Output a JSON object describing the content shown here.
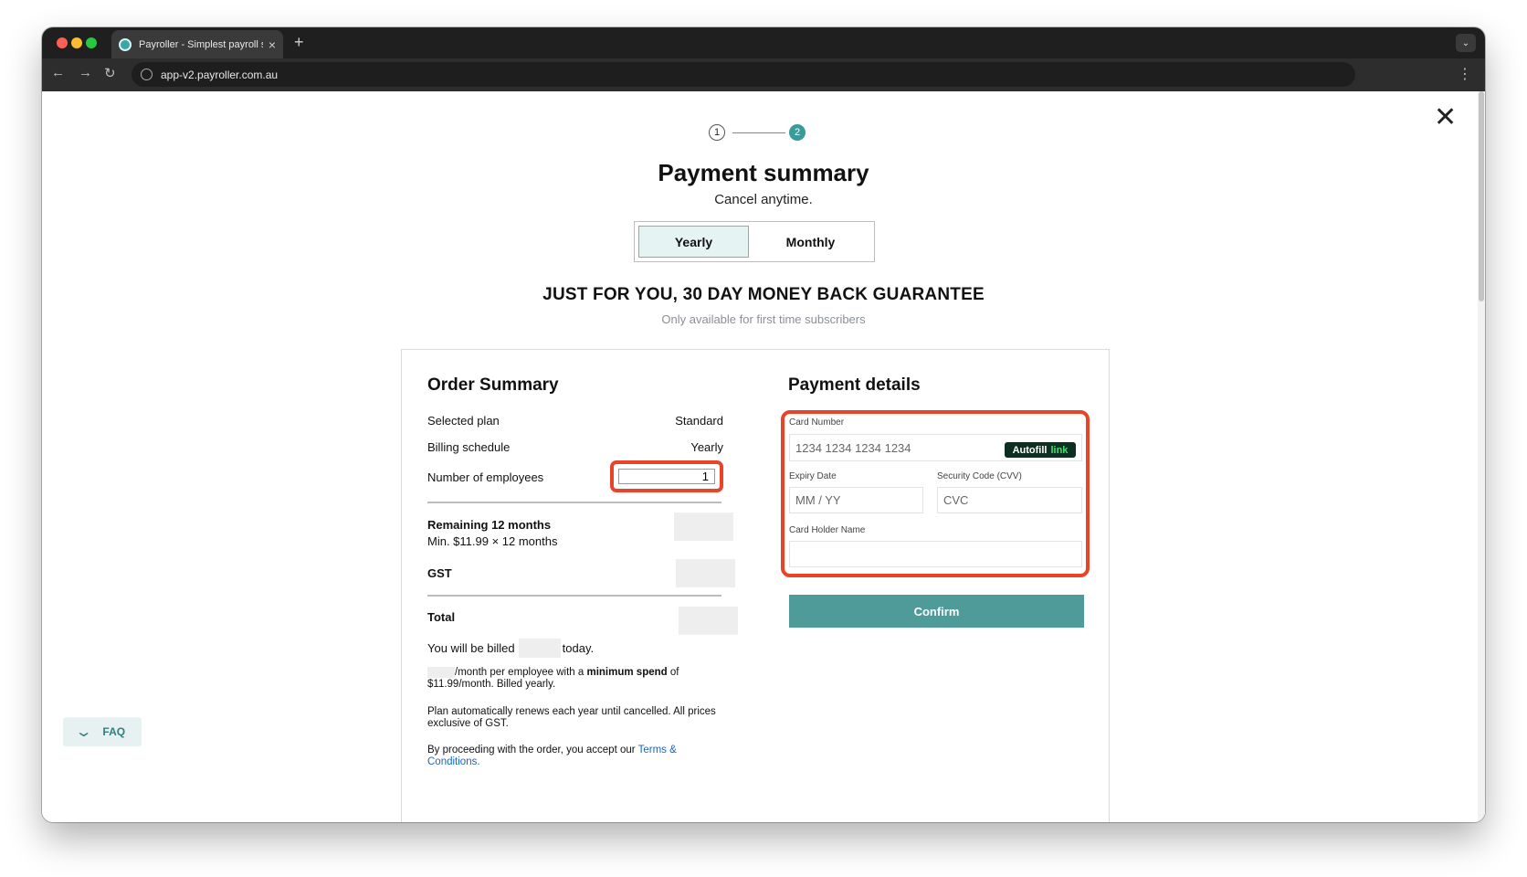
{
  "browser": {
    "tab_title": "Payroller - Simplest payroll so",
    "tab_close": "×",
    "new_tab": "+",
    "url": "app-v2.payroller.com.au",
    "back": "←",
    "forward": "→",
    "reload": "↻",
    "menu": "⋮",
    "tabs_menu": "⌄"
  },
  "page": {
    "close_icon": "✕",
    "steps": [
      "1",
      "2"
    ],
    "current_step": 2,
    "title": "Payment summary",
    "subtitle": "Cancel anytime.",
    "billing_options": [
      "Yearly",
      "Monthly"
    ],
    "selected_billing": "Yearly",
    "promo_heading": "JUST FOR YOU, 30 DAY MONEY BACK GUARANTEE",
    "promo_sub": "Only available for first time subscribers"
  },
  "order_summary": {
    "title": "Order Summary",
    "selected_plan_label": "Selected plan",
    "selected_plan_value": "Standard",
    "billing_schedule_label": "Billing schedule",
    "billing_schedule_value": "Yearly",
    "employees_label": "Number of employees",
    "employees_value": "1",
    "remaining_label": "Remaining 12 months",
    "remaining_detail": "Min. $11.99 × 12 months",
    "gst_label": "GST",
    "total_label": "Total",
    "billed_prefix": "You will be billed",
    "billed_suffix": "today.",
    "spend_pre": "/month per employee with a",
    "spend_bold": "minimum spend",
    "spend_post": "of $11.99/month. Billed yearly.",
    "renew_note": "Plan automatically renews each year until cancelled. All prices exclusive of GST.",
    "terms_pre": "By proceeding with the order, you accept our",
    "terms_link": "Terms & Conditions",
    "terms_post": "."
  },
  "payment": {
    "title": "Payment details",
    "card_number_label": "Card Number",
    "card_number_placeholder": "1234 1234 1234 1234",
    "autofill_label": "Autofill",
    "autofill_link": "link",
    "expiry_label": "Expiry Date",
    "expiry_placeholder": "MM / YY",
    "cvv_label": "Security Code (CVV)",
    "cvv_placeholder": "CVC",
    "holder_label": "Card Holder Name",
    "holder_value": "",
    "confirm_label": "Confirm"
  },
  "faq": {
    "label": "FAQ",
    "icon": "chevron-down-icon"
  },
  "colors": {
    "accent_teal": "#4f9b99",
    "highlight_red": "#e8442a",
    "link_blue": "#1a65c0"
  }
}
